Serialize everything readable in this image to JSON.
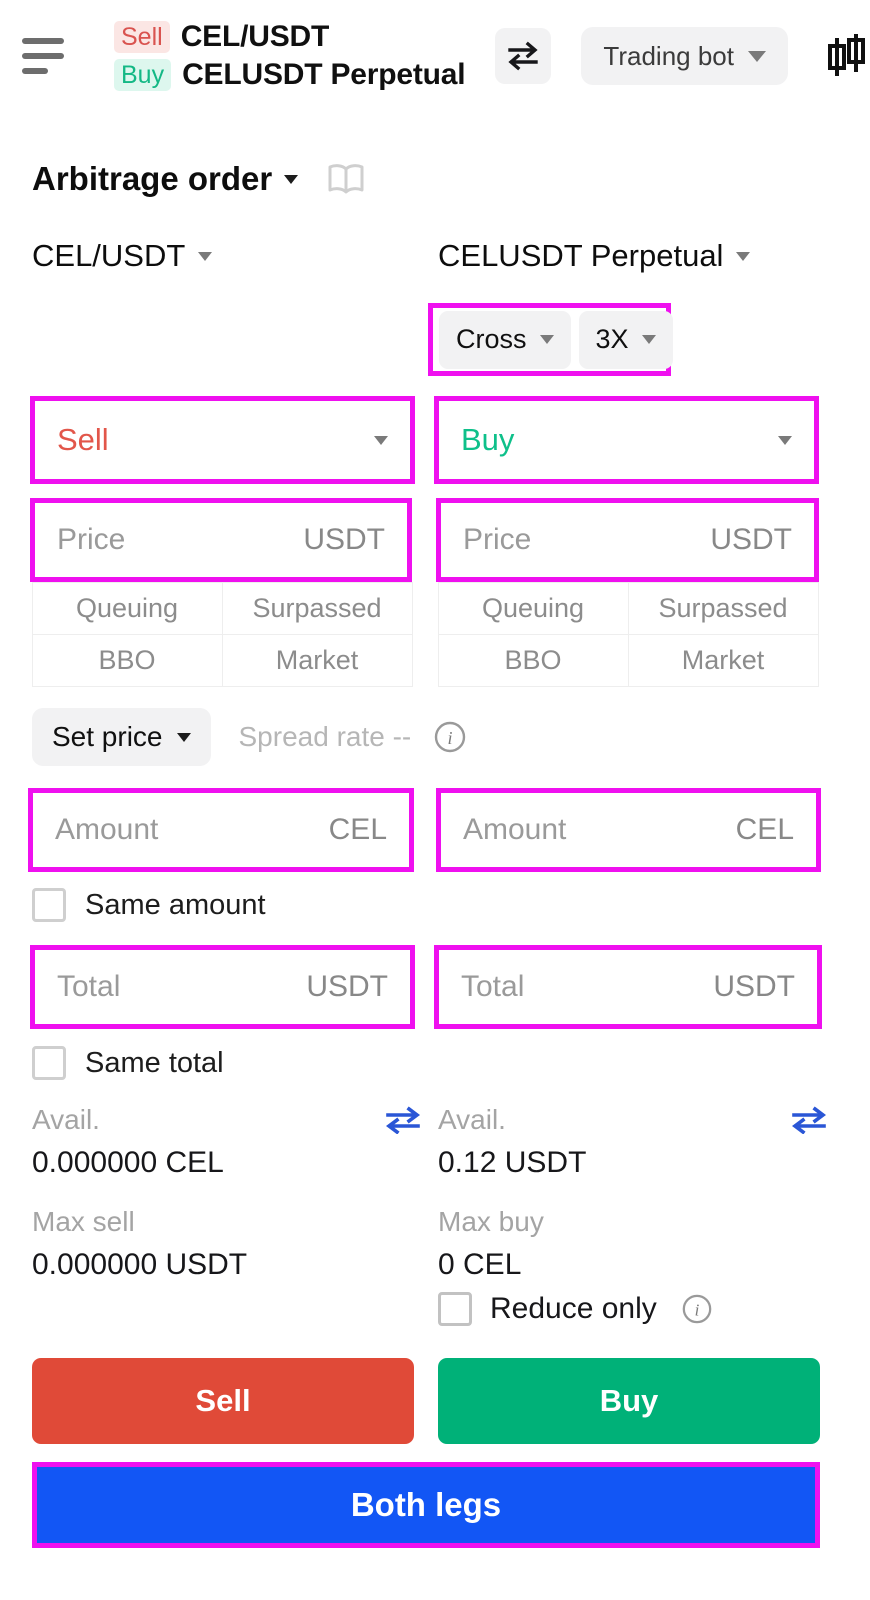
{
  "header": {
    "menu_icon": "hamburger-icon",
    "sell_tag": "Sell",
    "buy_tag": "Buy",
    "spot_pair": "CEL/USDT",
    "futures_pair": "CELUSDT Perpetual",
    "swap_icon": "swap-arrows-icon",
    "trading_bot_label": "Trading bot",
    "chart_icon": "candlestick-icon"
  },
  "order": {
    "type_label": "Arbitrage order",
    "book_icon": "open-book-icon"
  },
  "markets": {
    "left": "CEL/USDT",
    "right": "CELUSDT Perpetual"
  },
  "leverage": {
    "margin_mode": "Cross",
    "multiplier": "3X"
  },
  "sides": {
    "left": "Sell",
    "right": "Buy",
    "sell_color": "#e2564a",
    "buy_color": "#0ec08a"
  },
  "price": {
    "placeholder": "Price",
    "unit": "USDT",
    "tabs": [
      "Queuing",
      "Surpassed",
      "BBO",
      "Market"
    ]
  },
  "set_price": {
    "label": "Set price",
    "spread_rate": "Spread rate --",
    "info_icon": "info-icon"
  },
  "amount": {
    "placeholder": "Amount",
    "unit": "CEL",
    "same_label": "Same amount"
  },
  "total": {
    "placeholder": "Total",
    "unit": "USDT",
    "same_label": "Same total"
  },
  "avail_left": {
    "label": "Avail.",
    "value": "0.000000 CEL",
    "max_label": "Max sell",
    "max_value": "0.000000 USDT",
    "transfer_icon": "transfer-icon"
  },
  "avail_right": {
    "label": "Avail.",
    "value": "0.12 USDT",
    "max_label": "Max buy",
    "max_value": "0 CEL",
    "transfer_icon": "transfer-icon"
  },
  "reduce_only": {
    "label": "Reduce only",
    "info_icon": "info-icon"
  },
  "actions": {
    "sell": "Sell",
    "buy": "Buy",
    "both_legs": "Both legs",
    "sell_color": "#e04a38",
    "buy_color": "#00b178",
    "both_color": "#1256f5",
    "highlight_color": "#ef10ef"
  }
}
